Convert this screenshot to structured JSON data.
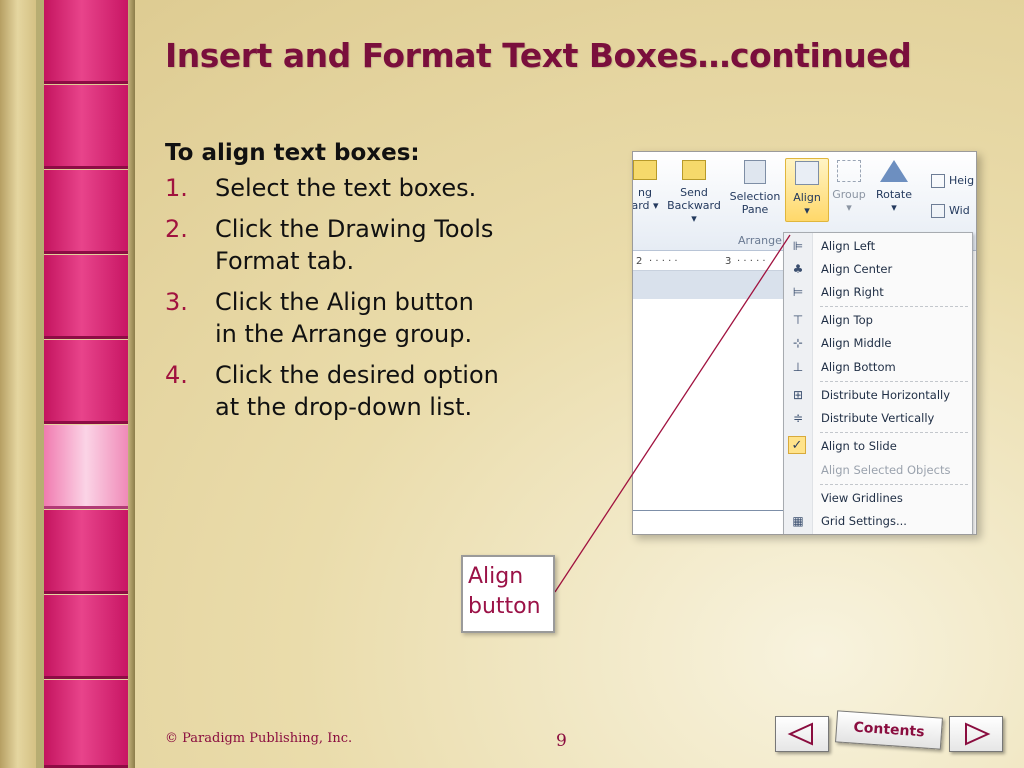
{
  "slide": {
    "title": "Insert and Format Text Boxes…continued",
    "heading": "To align text boxes:",
    "steps": [
      {
        "num": "1.",
        "line1": "Select the text boxes.",
        "line2": ""
      },
      {
        "num": "2.",
        "line1": "Click the Drawing Tools",
        "line2": "Format tab."
      },
      {
        "num": "3.",
        "line1": "Click the Align button",
        "line2": "in the Arrange group."
      },
      {
        "num": "4.",
        "line1": "Click the desired option",
        "line2": "at the drop-down list."
      }
    ],
    "callout": {
      "line1": "Align",
      "line2": "button"
    },
    "footer": "© Paradigm Publishing, Inc.",
    "page_number": "9",
    "nav": {
      "contents_label": "Contents"
    }
  },
  "ribbon": {
    "bring_forward": {
      "line1": "ng",
      "line2": "ard ▾"
    },
    "send_backward": {
      "line1": "Send",
      "line2": "Backward ▾"
    },
    "selection_pane": {
      "line1": "Selection",
      "line2": "Pane"
    },
    "align": {
      "label": "Align",
      "arrow": "▾"
    },
    "group": {
      "label": "Group",
      "arrow": "▾"
    },
    "rotate": {
      "label": "Rotate",
      "arrow": "▾"
    },
    "group_label": "Arrange",
    "height_label": "Heig",
    "width_label": "Wid",
    "ruler": {
      "mark2": "2",
      "mark3": "3",
      "ticks": "· · · · ·"
    }
  },
  "align_menu": {
    "items": [
      {
        "label": "Align Left",
        "icon": "align-left-icon",
        "glyph": "⊫"
      },
      {
        "label": "Align Center",
        "icon": "align-center-icon",
        "glyph": "♣"
      },
      {
        "label": "Align Right",
        "icon": "align-right-icon",
        "glyph": "⊨"
      },
      {
        "label": "Align Top",
        "icon": "align-top-icon",
        "glyph": "⊤"
      },
      {
        "label": "Align Middle",
        "icon": "align-middle-icon",
        "glyph": "⊹"
      },
      {
        "label": "Align Bottom",
        "icon": "align-bottom-icon",
        "glyph": "⊥"
      },
      {
        "label": "Distribute Horizontally",
        "icon": "distribute-horizontally-icon",
        "glyph": "⊞"
      },
      {
        "label": "Distribute Vertically",
        "icon": "distribute-vertically-icon",
        "glyph": "≑"
      },
      {
        "label": "Align to Slide",
        "icon": "check-icon",
        "glyph": "✓"
      },
      {
        "label": "Align Selected Objects",
        "icon": "",
        "glyph": ""
      },
      {
        "label": "View Gridlines",
        "icon": "",
        "glyph": ""
      },
      {
        "label": "Grid Settings...",
        "icon": "grid-icon",
        "glyph": "▦"
      }
    ]
  },
  "colors": {
    "title": "#7a0f3c",
    "number": "#a0123f",
    "accent_pink": "#e8448b",
    "background": "#eadcab"
  }
}
